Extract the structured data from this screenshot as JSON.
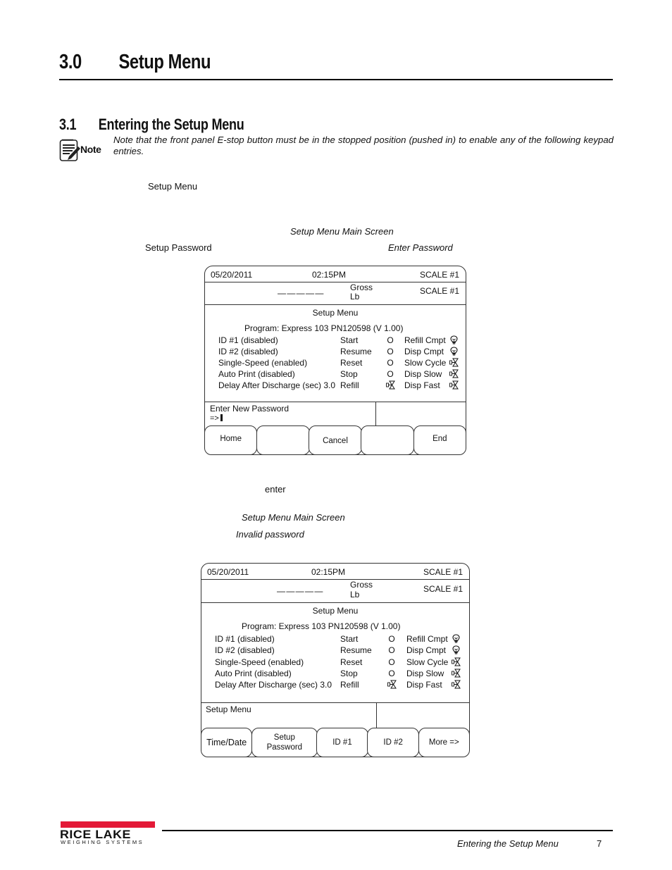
{
  "heading1": {
    "number": "3.0",
    "title": "Setup Menu"
  },
  "heading2": {
    "number": "3.1",
    "title": "Entering the Setup Menu"
  },
  "note": {
    "label": "Note",
    "icon": "note-pad-pencil-icon",
    "text": "Note that the front panel E-stop button must be in the stopped position (pushed in) to enable any of the following keypad entries."
  },
  "body_fragments": {
    "setup_menu": "Setup  Menu",
    "setup_menu_main_screen_1": "Setup Menu Main Screen",
    "setup_password": "Setup Password",
    "enter_password": "Enter Password",
    "enter": "enter",
    "setup_menu_main_screen_2": "Setup Menu Main Screen",
    "invalid_password": "Invalid password"
  },
  "screen1": {
    "date": "05/20/2011",
    "time": "02:15PM",
    "scale_top": "SCALE #1",
    "weight_dashes": "— — — — —",
    "mode": "Gross",
    "unit": "Lb",
    "scale_right": "SCALE #1",
    "menu_title": "Setup Menu",
    "program": "Program: Express 103 PN120598  (V 1.00)",
    "settings": [
      "ID #1 (disabled)",
      "ID #2 (disabled)",
      "Single-Speed (enabled)",
      "Auto Print (disabled)",
      "Delay After Discharge (sec) 3.0"
    ],
    "inputs": [
      {
        "label": "Start",
        "state": "O",
        "icon": ""
      },
      {
        "label": "Resume",
        "state": "O",
        "icon": ""
      },
      {
        "label": "Reset",
        "state": "O",
        "icon": ""
      },
      {
        "label": "Stop",
        "state": "O",
        "icon": ""
      },
      {
        "label": "Refill",
        "state": "",
        "icon": "valve-icon"
      }
    ],
    "outputs": [
      {
        "label": "Refill Cmpt",
        "icon": "lightbulb-icon"
      },
      {
        "label": "Disp Cmpt",
        "icon": "lightbulb-icon"
      },
      {
        "label": "Slow Cycle",
        "icon": "valve-icon"
      },
      {
        "label": "Disp Slow",
        "icon": "valve-icon"
      },
      {
        "label": "Disp Fast",
        "icon": "valve-icon"
      }
    ],
    "prompt": "Enter New Password",
    "prompt_input": "=>",
    "softkeys": [
      "Home",
      "",
      "Cancel",
      "",
      "End"
    ]
  },
  "screen2": {
    "date": "05/20/2011",
    "time": "02:15PM",
    "scale_top": "SCALE #1",
    "weight_dashes": "— — — — —",
    "mode": "Gross",
    "unit": "Lb",
    "scale_right": "SCALE #1",
    "menu_title": "Setup Menu",
    "program": "Program: Express 103 PN120598  (V 1.00)",
    "settings": [
      "ID #1 (disabled)",
      "ID #2 (disabled)",
      "Single-Speed (enabled)",
      "Auto Print (disabled)",
      "Delay After Discharge (sec) 3.0"
    ],
    "inputs": [
      {
        "label": "Start",
        "state": "O",
        "icon": ""
      },
      {
        "label": "Resume",
        "state": "O",
        "icon": ""
      },
      {
        "label": "Reset",
        "state": "O",
        "icon": ""
      },
      {
        "label": "Stop",
        "state": "O",
        "icon": ""
      },
      {
        "label": "Refill",
        "state": "",
        "icon": "valve-icon"
      }
    ],
    "outputs": [
      {
        "label": "Refill Cmpt",
        "icon": "lightbulb-icon"
      },
      {
        "label": "Disp Cmpt",
        "icon": "lightbulb-icon"
      },
      {
        "label": "Slow Cycle",
        "icon": "valve-icon"
      },
      {
        "label": "Disp Slow",
        "icon": "valve-icon"
      },
      {
        "label": "Disp Fast",
        "icon": "valve-icon"
      }
    ],
    "prompt": "Setup Menu",
    "prompt_input": "",
    "softkeys": [
      "Time/Date",
      "Setup Password",
      "ID #1",
      "ID #2",
      "More =>"
    ]
  },
  "footer": {
    "logo_main": "RICE LAKE",
    "logo_sub": "WEIGHING SYSTEMS",
    "logo_color": "#e31937",
    "section_title": "Entering the Setup Menu",
    "page_number": "7"
  }
}
